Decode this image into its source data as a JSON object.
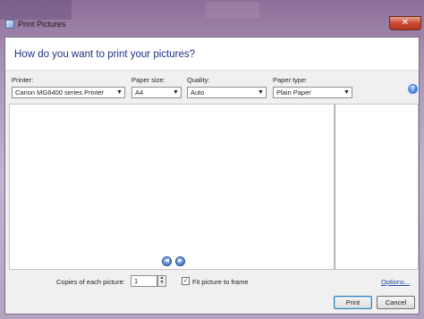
{
  "window": {
    "title": "Print Pictures",
    "close_glyph": "✕"
  },
  "header": {
    "question": "How do you want to print your pictures?"
  },
  "printer": {
    "label": "Printer:",
    "value": "Canon MG6400 series Printer"
  },
  "paper_size": {
    "label": "Paper size:",
    "value": "A4"
  },
  "quality": {
    "label": "Quality:",
    "value": "Auto"
  },
  "paper_type": {
    "label": "Paper type:",
    "value": "Plain Paper"
  },
  "help": {
    "glyph": "?"
  },
  "preview": {
    "prev_glyph": "◀",
    "next_glyph": "▶"
  },
  "copies": {
    "label": "Copies of each picture:",
    "value": "1"
  },
  "fit": {
    "label": "Fit picture to frame",
    "checked_glyph": "✓"
  },
  "options_link": "Options...",
  "buttons": {
    "print": "Print",
    "cancel": "Cancel"
  },
  "icons": [
    "app-icon",
    "close-icon",
    "help-icon",
    "previous-page-icon",
    "next-page-icon",
    "dropdown-arrow-icon",
    "spinner-up-icon",
    "spinner-down-icon",
    "checkmark-icon"
  ],
  "colors": {
    "header_text": "#1e3287",
    "link": "#1f4ea8",
    "close_button": "#c8452e"
  }
}
